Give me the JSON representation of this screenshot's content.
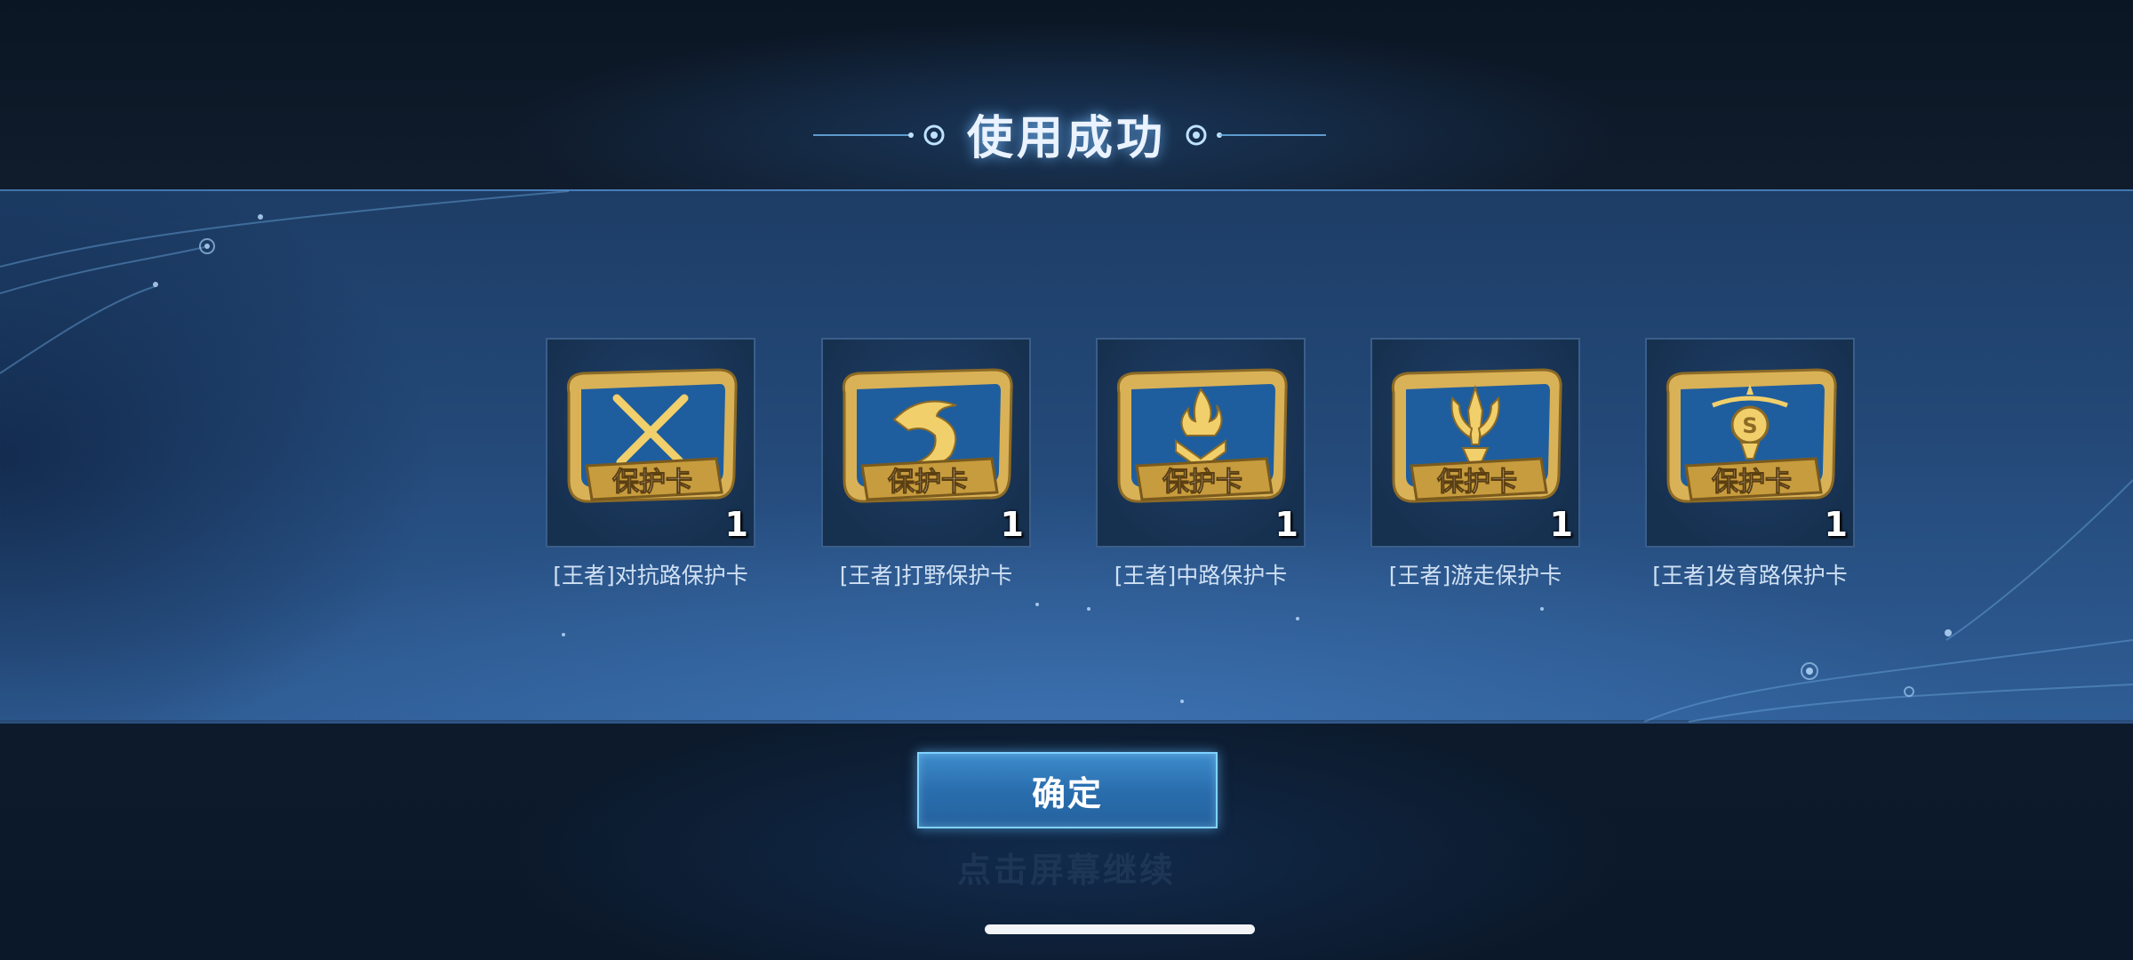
{
  "dialog": {
    "title": "使用成功",
    "confirm_label": "确定",
    "continue_hint": "点击屏幕继续"
  },
  "items": [
    {
      "label": "[王者]对抗路保护卡",
      "count": "1",
      "badge_text": "保护卡",
      "icon": "crossed-swords-icon"
    },
    {
      "label": "[王者]打野保护卡",
      "count": "1",
      "badge_text": "保护卡",
      "icon": "dragon-icon"
    },
    {
      "label": "[王者]中路保护卡",
      "count": "1",
      "badge_text": "保护卡",
      "icon": "flame-chevron-icon"
    },
    {
      "label": "[王者]游走保护卡",
      "count": "1",
      "badge_text": "保护卡",
      "icon": "trident-icon"
    },
    {
      "label": "[王者]发育路保护卡",
      "count": "1",
      "badge_text": "保护卡",
      "icon": "coin-crest-icon"
    }
  ],
  "colors": {
    "card_gold": "#d9b257",
    "card_blue": "#1f5e9e",
    "button_border": "#7fd2ff",
    "panel_blue": "#244a7a"
  }
}
